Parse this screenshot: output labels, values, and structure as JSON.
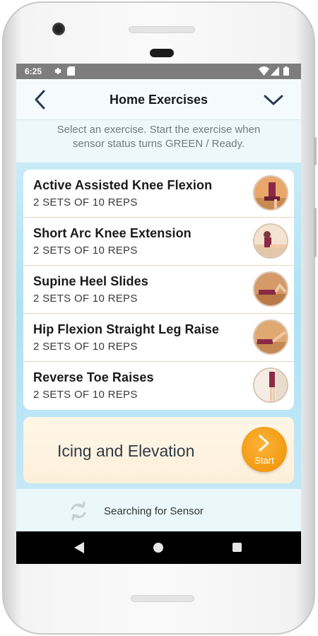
{
  "status_bar": {
    "time": "6:25",
    "icons": [
      "settings-icon",
      "sd-card-icon",
      "wifi-icon",
      "signal-icon",
      "battery-icon"
    ]
  },
  "header": {
    "title": "Home Exercises",
    "back_icon": "chevron-left-icon",
    "menu_icon": "chevron-down-icon"
  },
  "instructions": {
    "line1": "Select an exercise. Start the exercise when",
    "line2": "sensor status turns GREEN / Ready."
  },
  "exercises": [
    {
      "name": "Active Assisted Knee Flexion",
      "reps": "2 SETS OF 10 REPS"
    },
    {
      "name": "Short Arc Knee Extension",
      "reps": "2 SETS OF 10 REPS"
    },
    {
      "name": "Supine Heel Slides",
      "reps": "2 SETS OF 10 REPS"
    },
    {
      "name": "Hip Flexion Straight Leg Raise",
      "reps": "2 SETS OF 10 REPS"
    },
    {
      "name": "Reverse Toe Raises",
      "reps": "2 SETS OF 10 REPS"
    }
  ],
  "icing": {
    "label": "Icing and Elevation",
    "start_label": "Start"
  },
  "sensor": {
    "status_text": "Searching for Sensor",
    "icon": "sync-icon"
  },
  "nav": {
    "icons": [
      "nav-back-icon",
      "nav-home-icon",
      "nav-recents-icon"
    ]
  },
  "colors": {
    "accent_orange": "#f39a12",
    "status_bar": "#7d7d7d",
    "list_background": "#aee2f3"
  }
}
